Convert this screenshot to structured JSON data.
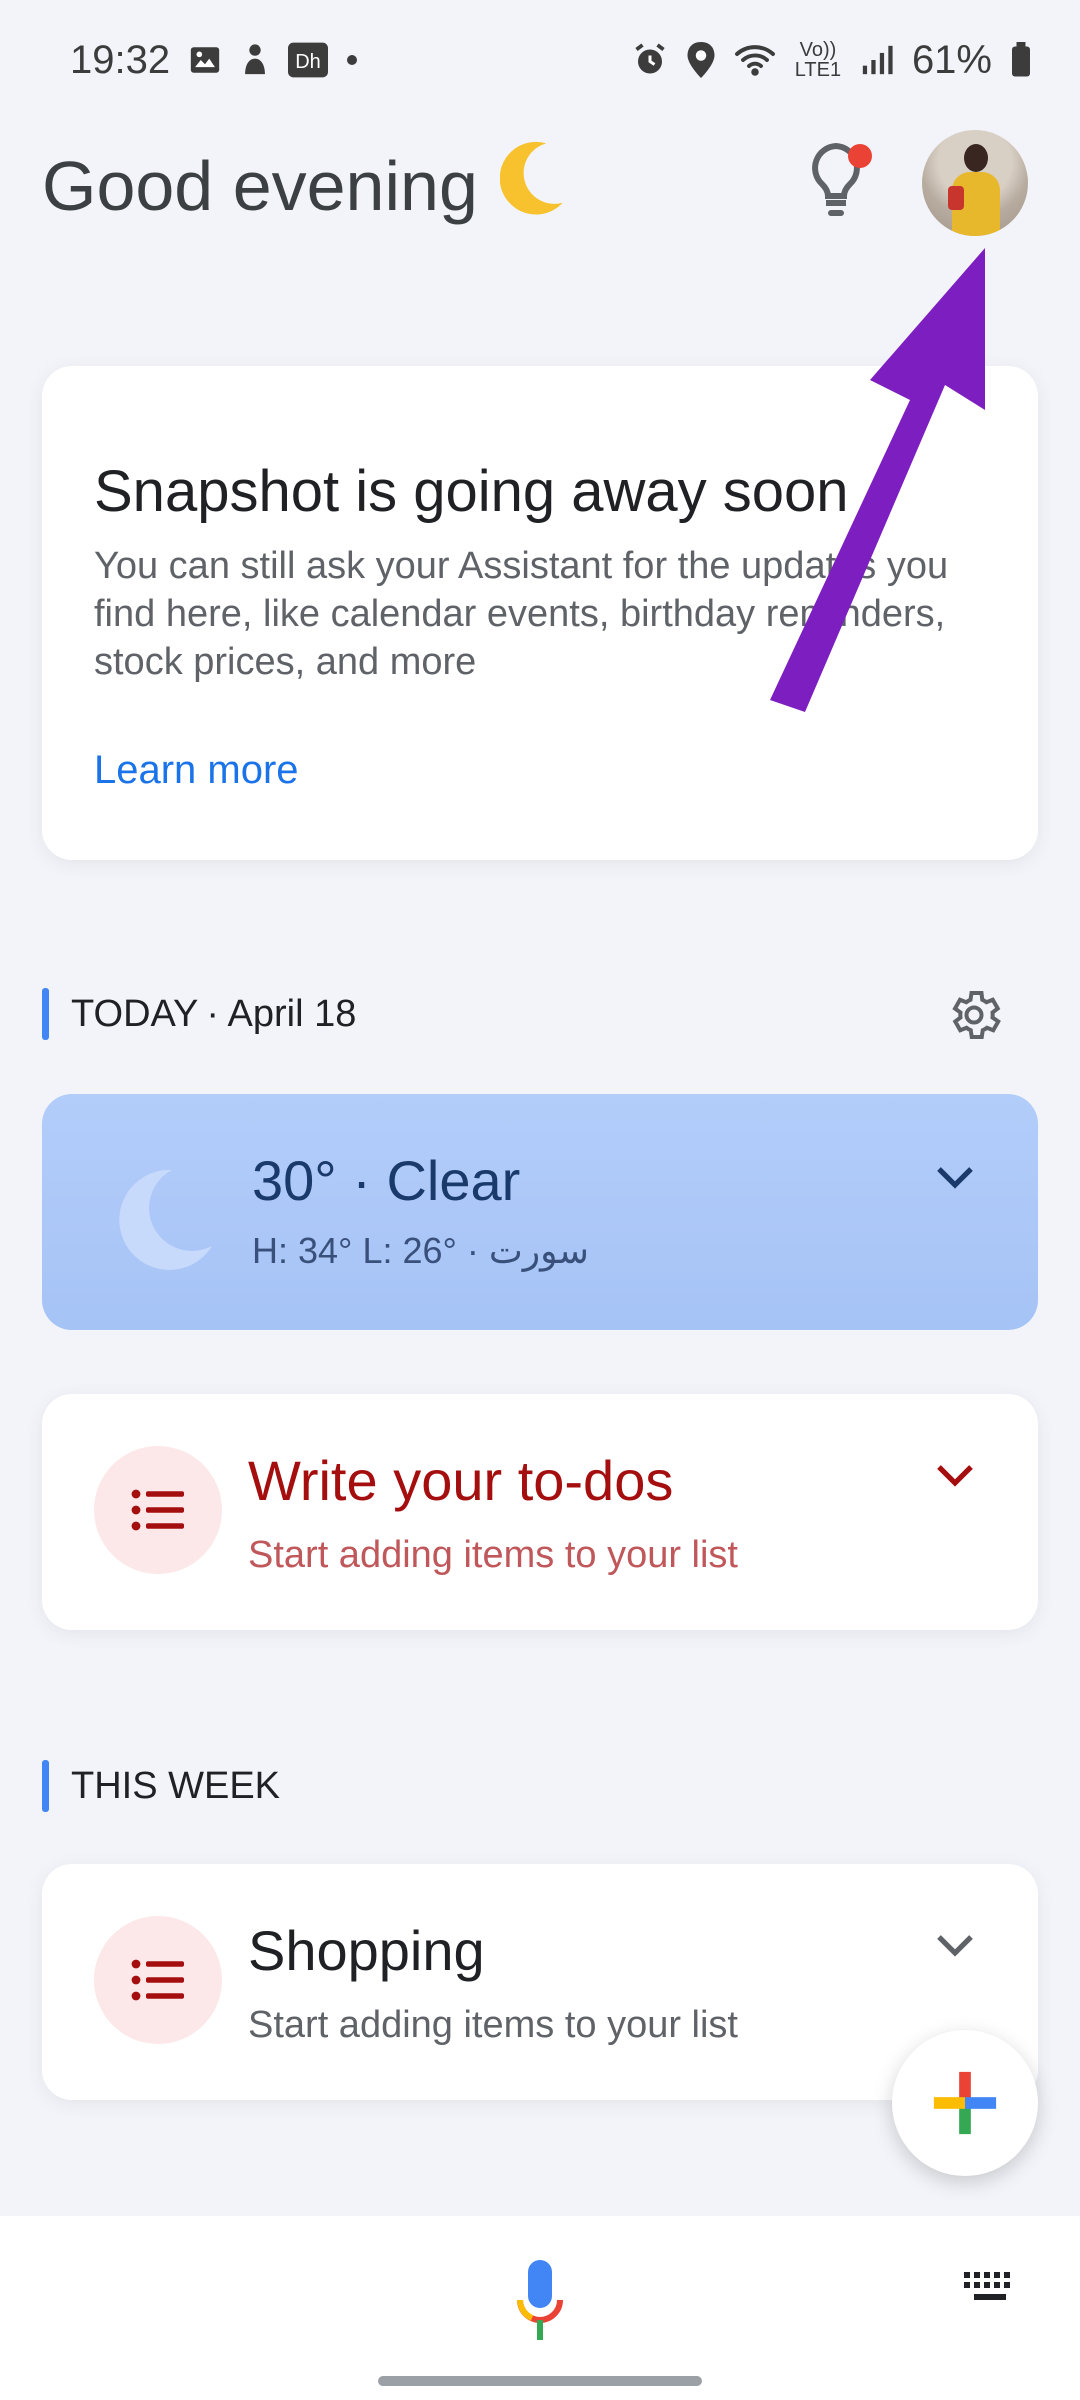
{
  "status_bar": {
    "time": "19:32",
    "network_label": "Vo)) LTE1",
    "battery": "61%",
    "icons": [
      "gallery-icon",
      "app-notification-icon",
      "app-badge-icon",
      "dot-icon",
      "alarm-icon",
      "location-icon",
      "wifi-icon",
      "signal-icon",
      "battery-icon"
    ]
  },
  "header": {
    "greeting": "Good evening",
    "moon_emoji": "🌙",
    "updates_icon": "lightbulb-icon",
    "notification_color": "#ea4335",
    "account": "avatar"
  },
  "snapshot_card": {
    "title": "Snapshot is going away soon",
    "body": "You can still ask your Assistant for the updates you find here, like calendar events, birthday reminders, stock prices, and more",
    "link": "Learn more"
  },
  "today": {
    "label": "TODAY",
    "date": "· April 18",
    "settings_icon": "gear-icon"
  },
  "weather": {
    "main": "30° · Clear",
    "sub": "H: 34° L: 26° · سورت",
    "icon": "moon-icon"
  },
  "todos": {
    "title": "Write your to-dos",
    "subtitle": "Start adding items to your list",
    "icon": "list-icon"
  },
  "this_week": {
    "label": "THIS WEEK"
  },
  "shopping": {
    "title": "Shopping",
    "subtitle": "Start adding items to your list",
    "icon": "list-icon"
  },
  "bottom_bar": {
    "mic": "mic-icon",
    "keyboard": "keyboard-icon"
  },
  "colors": {
    "accent": "#4285f4",
    "link": "#1a73e8",
    "todo_red": "#a50e0e",
    "arrow_purple": "#7d1fc0",
    "weather_bg": "#aac6f7"
  }
}
